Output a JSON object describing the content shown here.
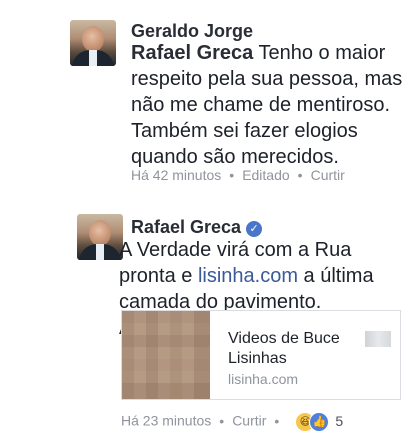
{
  "comments": [
    {
      "author": "Geraldo Jorge",
      "tag": "Rafael Greca",
      "text": " Tenho o maior respeito pela sua pessoa, mas não me chame de mentiroso. Também sei fazer elogios quando são merecidos.",
      "time": "Há 42 minutos",
      "edited": "Editado",
      "like": "Curtir"
    },
    {
      "author": "Rafael Greca",
      "text_before": "A Verdade virá com a Rua pronta e ",
      "link": "lisinha.com",
      "text_after": " a última camada do pavimento. Aguarde dia 29.",
      "preview": {
        "title": "Videos de Buce Lisinhas",
        "domain": "lisinha.com"
      },
      "time": "Há 23 minutos",
      "like": "Curtir",
      "reaction_count": "5"
    }
  ],
  "icons": {
    "verified": "verified-badge-icon",
    "haha": "haha-reaction-icon",
    "like": "like-reaction-icon"
  }
}
